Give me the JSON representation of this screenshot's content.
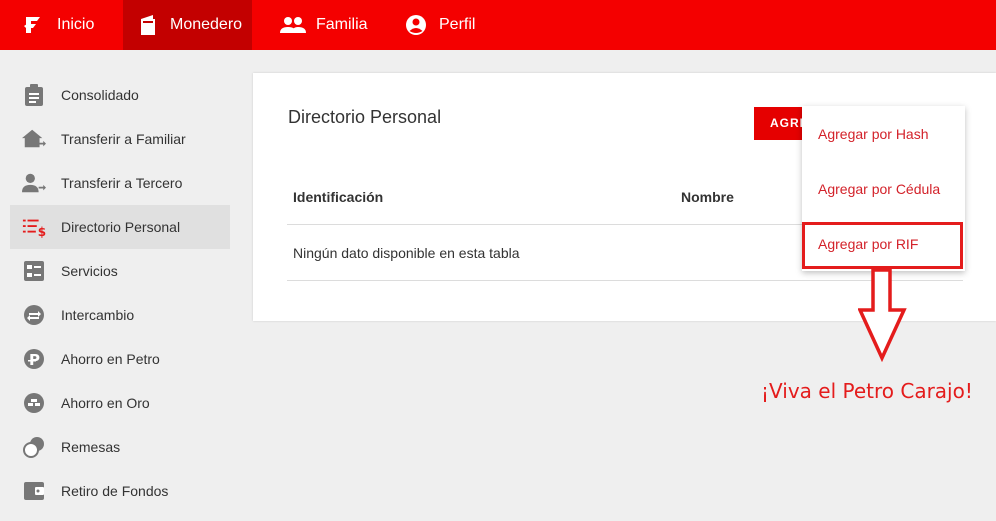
{
  "topnav": {
    "items": [
      {
        "label": "Inicio",
        "icon": "petro-logo-icon"
      },
      {
        "label": "Monedero",
        "icon": "wallet-icon",
        "active": true
      },
      {
        "label": "Familia",
        "icon": "people-icon"
      },
      {
        "label": "Perfil",
        "icon": "account-circle-icon"
      }
    ],
    "bg_color": "#f40000",
    "active_color": "#c30000"
  },
  "sidebar": {
    "items": [
      {
        "label": "Consolidado",
        "icon": "clipboard-icon"
      },
      {
        "label": "Transferir a Familiar",
        "icon": "home-transfer-icon"
      },
      {
        "label": "Transferir a Tercero",
        "icon": "person-transfer-icon"
      },
      {
        "label": "Directorio Personal",
        "icon": "list-dollar-icon",
        "active": true
      },
      {
        "label": "Servicios",
        "icon": "services-icon"
      },
      {
        "label": "Intercambio",
        "icon": "exchange-icon"
      },
      {
        "label": "Ahorro en Petro",
        "icon": "petro-coin-icon"
      },
      {
        "label": "Ahorro en Oro",
        "icon": "gold-icon"
      },
      {
        "label": "Remesas",
        "icon": "remittance-icon"
      },
      {
        "label": "Retiro de Fondos",
        "icon": "withdraw-icon"
      }
    ]
  },
  "card": {
    "title": "Directorio Personal",
    "add_button_label": "AGREGAR",
    "table": {
      "headers": [
        "Identificación",
        "Nombre"
      ],
      "empty_message": "Ningún dato disponible en esta tabla"
    }
  },
  "dropdown": {
    "items": [
      "Agregar por Hash",
      "Agregar por Cédula",
      "Agregar por RIF"
    ],
    "highlighted_index": 2,
    "text_color": "#d3222a"
  },
  "annotation": {
    "slogan": "¡Viva el Petro Carajo!",
    "color": "#e41c1c"
  }
}
